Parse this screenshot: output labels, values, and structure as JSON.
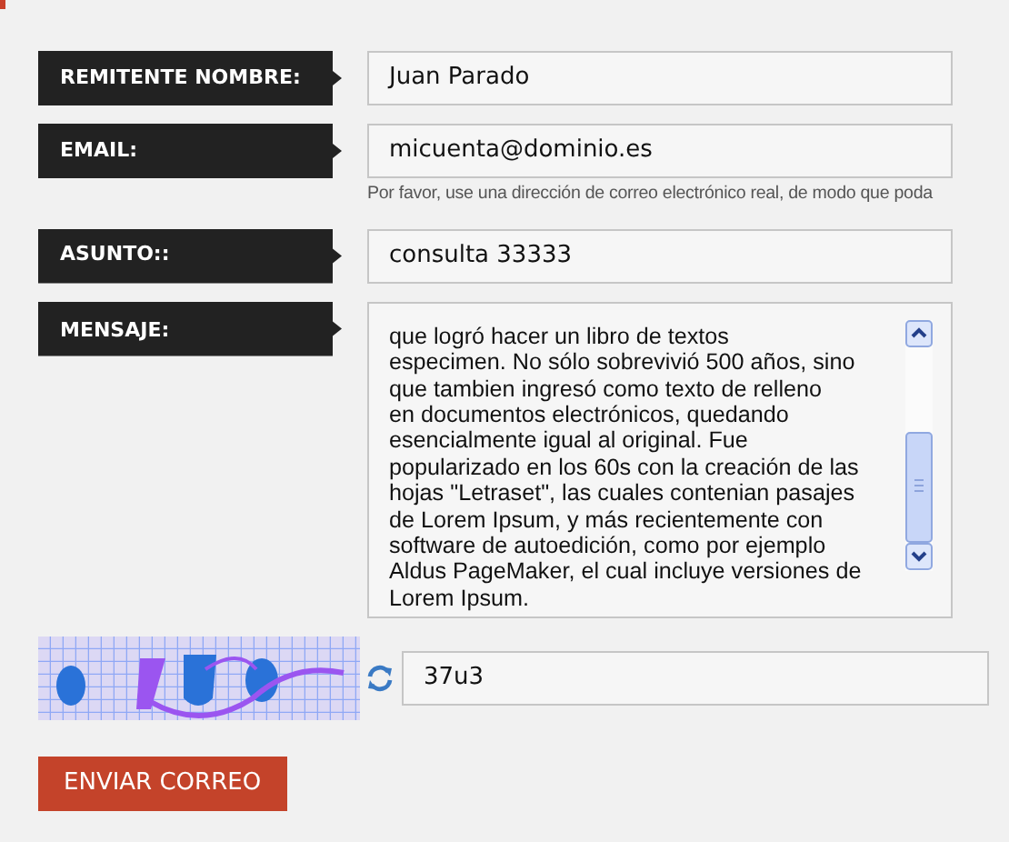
{
  "form": {
    "fields": [
      {
        "kind": "text",
        "label": "REMITENTE NOMBRE:",
        "value": "Juan Parado"
      },
      {
        "kind": "text",
        "label": "EMAIL:",
        "value": "micuenta@dominio.es",
        "hint": "Por favor, use una dirección de correo electrónico real, de modo que poda"
      },
      {
        "kind": "text",
        "label": "ASUNTO::",
        "value": "consulta 33333"
      },
      {
        "kind": "textarea",
        "label": "MENSAJE:",
        "lines": [
          "que logró hacer un libro de textos",
          "especimen. No sólo sobrevivió 500 años, sino",
          "que tambien ingresó como texto de relleno",
          "en documentos electrónicos, quedando",
          "esencialmente igual al original. Fue",
          "popularizado en los 60s con la creación de las",
          "hojas \"Letraset\", las cuales contenian pasajes",
          "de Lorem Ipsum, y más recientemente con",
          "software de autoedición, como por ejemplo",
          "Aldus PageMaker, el cual incluye versiones de",
          "Lorem Ipsum."
        ]
      }
    ],
    "captcha": {
      "value": "37u3"
    },
    "submit": "ENVIAR CORREO"
  }
}
